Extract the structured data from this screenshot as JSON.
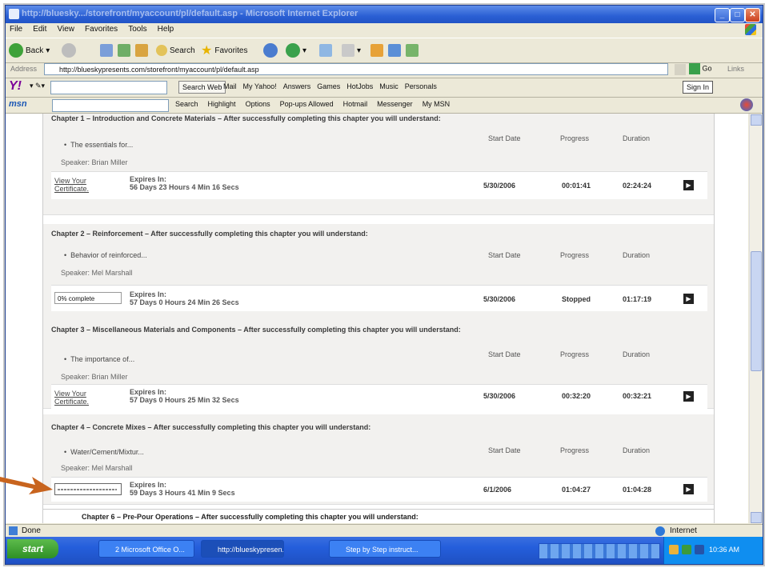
{
  "window": {
    "title": "http://bluesky.../storefront/myaccount/pl/default.asp - Microsoft Internet Explorer"
  },
  "menu": [
    "File",
    "Edit",
    "View",
    "Favorites",
    "Tools",
    "Help"
  ],
  "toolbar": {
    "back_label": "Back",
    "search_label": "Search",
    "favorites_label": "Favorites"
  },
  "address": {
    "label": "Address",
    "url": "http://blueskypresents.com/storefront/myaccount/pl/default.asp",
    "go_label": "Go",
    "links_label": "Links"
  },
  "yahoo_bar": {
    "search_web_label": "Search Web",
    "items": [
      "Mail",
      "My Yahoo!",
      "Answers",
      "Games",
      "HotJobs",
      "Music",
      "Personals"
    ],
    "sign_in_label": "Sign In"
  },
  "msn_bar": {
    "items": [
      "Search",
      "Highlight",
      "Options",
      "Pop-ups Allowed",
      "Hotmail",
      "Messenger",
      "My MSN"
    ]
  },
  "columns": {
    "start_date": "Start Date",
    "progress": "Progress",
    "duration": "Duration"
  },
  "chapters": [
    {
      "title": "Chapter 1 – Introduction and Concrete Materials – After successfully completing this chapter you will understand:",
      "bullet": "The essentials for...",
      "speaker": "Speaker: Brian Miller",
      "status": "View Your Certificate.",
      "expires_label": "Expires In:",
      "expires": "56 Days 23 Hours 4 Min 16 Secs",
      "start_date": "5/30/2006",
      "progress": "00:01:41",
      "duration": "02:24:24"
    },
    {
      "title": "Chapter 2 – Reinforcement – After successfully completing this chapter you will understand:",
      "bullet": "Behavior of reinforced...",
      "speaker": "Speaker: Mel Marshall",
      "status": "0% complete",
      "expires_label": "Expires In:",
      "expires": "57 Days 0 Hours 24 Min 26 Secs",
      "start_date": "5/30/2006",
      "progress": "Stopped",
      "duration": "01:17:19"
    },
    {
      "title": "Chapter 3 – Miscellaneous Materials and Components – After successfully completing this chapter you will understand:",
      "bullet": "The importance of...",
      "speaker": "Speaker: Brian Miller",
      "status": "View Your Certificate.",
      "expires_label": "Expires In:",
      "expires": "57 Days 0 Hours 25 Min 32 Secs",
      "start_date": "5/30/2006",
      "progress": "00:32:20",
      "duration": "00:32:21"
    },
    {
      "title": "Chapter 4 – Concrete Mixes – After successfully completing this chapter you will understand:",
      "bullet": "Water/Cement/Mixtur...",
      "speaker": "Speaker: Mel Marshall",
      "status": "",
      "expires_label": "Expires In:",
      "expires": "59 Days 3 Hours 41 Min 9 Secs",
      "start_date": "6/1/2006",
      "progress": "01:04:27",
      "duration": "01:04:28"
    }
  ],
  "next_chapter_title": "Chapter 6 – Pre-Pour Operations – After successfully completing this chapter you will understand:",
  "status_bar": {
    "left": "Done",
    "zone": "Internet"
  },
  "taskbar": {
    "start_label": "start",
    "tasks": [
      "2 Microsoft Office O...",
      "http://blueskypresen...",
      "Step by Step instruct..."
    ],
    "clock": "10:36 AM"
  },
  "colors": {
    "annotation_arrow": "#c8641e",
    "title_bar": "#2a5fd4"
  }
}
